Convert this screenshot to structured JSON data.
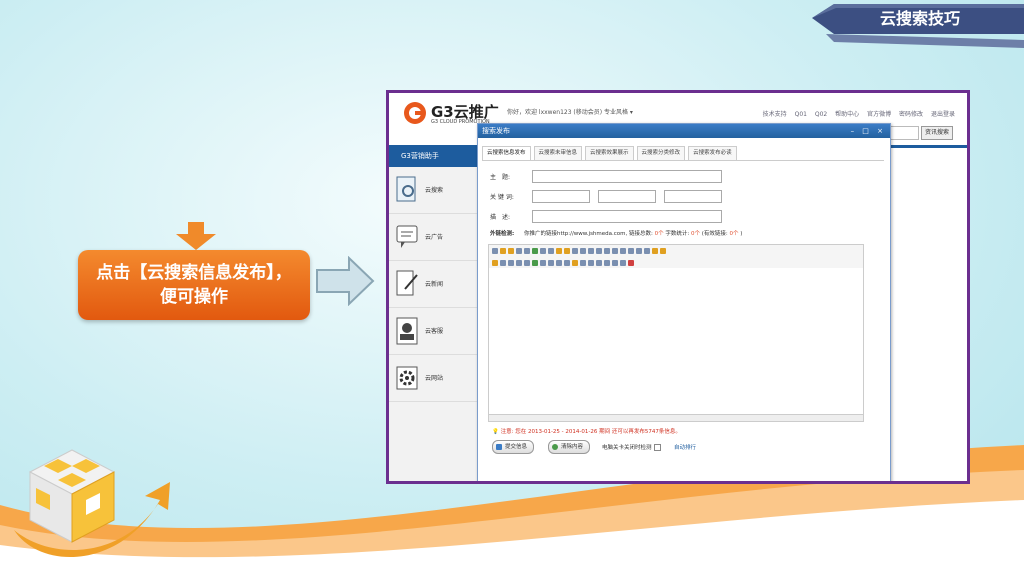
{
  "slide": {
    "ribbon_title": "云搜索技巧",
    "callout_text": "点击【云搜索信息发布】，便可操作"
  },
  "app": {
    "brand_name": "G3云推广",
    "brand_sub": "G3 CLOUD PROMOTION",
    "welcome": "你好，欢迎 lxxwen123 (移动会员)  专业风格 ▾",
    "top_nav": [
      "技术支持",
      "Q01",
      "Q02",
      "帮助中心",
      "官方微博",
      "密码修改",
      "退出登录"
    ],
    "search_button": "资讯搜索",
    "sidebar_title": "G3营销助手",
    "sidebar_items": [
      "云搜索",
      "云广告",
      "云新闻",
      "云客服",
      "云网站"
    ]
  },
  "dialog": {
    "title": "搜索发布",
    "window_controls": "– □ ×",
    "tabs": [
      "云搜索信息发布",
      "云搜索未审信息",
      "云搜索效果展示",
      "云搜索分类修改",
      "云搜索发布必读"
    ],
    "fields": {
      "subject_label": "主　题:",
      "keywords_label": "关 键 词:",
      "desc_label": "描　述:"
    },
    "external_label": "外链检测:",
    "external_text": "你推广的链接http://www.jshmeda.com, 链接总数:",
    "external_count": "0个",
    "word_stat": "字数统计:",
    "word_count": "0个",
    "valid_links": "(有效链接:",
    "valid_count": "0个",
    "valid_close": ")",
    "notice": "注意: 您在 2013-01-25 - 2014-01-26 期间 还可以再发布5747条信息。",
    "submit_button": "提交信息",
    "clear_button": "清除内容",
    "checkbox_label": "电脑关卡关闭时检测",
    "auto_label": "自动排行"
  },
  "colors": {
    "frame_border": "#6b2f8f",
    "callout": "#ef7a22",
    "app_blue": "#1d5c9e"
  }
}
